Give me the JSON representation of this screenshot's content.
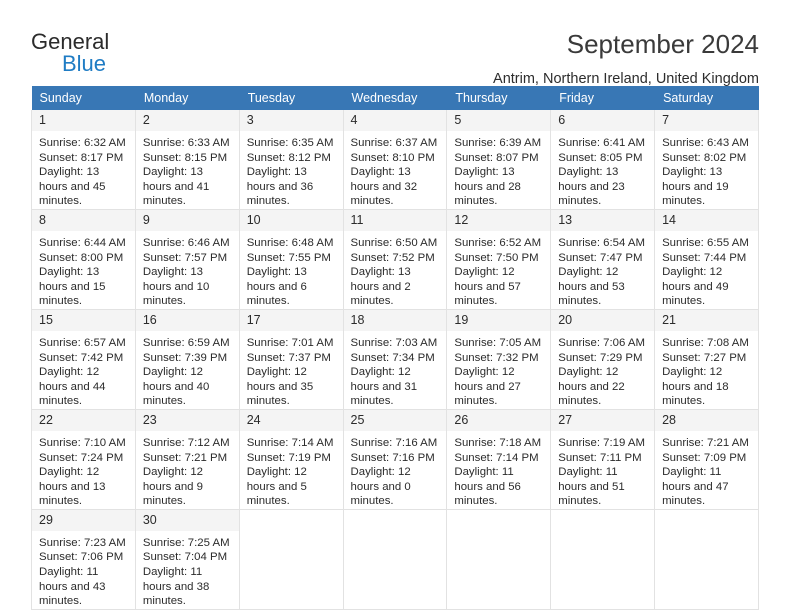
{
  "brand": {
    "name_part1": "General",
    "name_part2": "Blue",
    "triangle_color": "#1f7cc4"
  },
  "header": {
    "title": "September 2024",
    "location": "Antrim, Northern Ireland, United Kingdom"
  },
  "theme": {
    "header_blue": "#3877b5",
    "daynum_band": "#f4f4f4",
    "grid_border": "#e2e2e2"
  },
  "weekdays": [
    "Sunday",
    "Monday",
    "Tuesday",
    "Wednesday",
    "Thursday",
    "Friday",
    "Saturday"
  ],
  "labels": {
    "sunrise_prefix": "Sunrise:",
    "sunset_prefix": "Sunset:",
    "daylight_prefix": "Daylight:"
  },
  "weeks": [
    [
      {
        "day": "1",
        "sunrise": "Sunrise: 6:32 AM",
        "sunset": "Sunset: 8:17 PM",
        "daylight": "Daylight: 13 hours and 45 minutes."
      },
      {
        "day": "2",
        "sunrise": "Sunrise: 6:33 AM",
        "sunset": "Sunset: 8:15 PM",
        "daylight": "Daylight: 13 hours and 41 minutes."
      },
      {
        "day": "3",
        "sunrise": "Sunrise: 6:35 AM",
        "sunset": "Sunset: 8:12 PM",
        "daylight": "Daylight: 13 hours and 36 minutes."
      },
      {
        "day": "4",
        "sunrise": "Sunrise: 6:37 AM",
        "sunset": "Sunset: 8:10 PM",
        "daylight": "Daylight: 13 hours and 32 minutes."
      },
      {
        "day": "5",
        "sunrise": "Sunrise: 6:39 AM",
        "sunset": "Sunset: 8:07 PM",
        "daylight": "Daylight: 13 hours and 28 minutes."
      },
      {
        "day": "6",
        "sunrise": "Sunrise: 6:41 AM",
        "sunset": "Sunset: 8:05 PM",
        "daylight": "Daylight: 13 hours and 23 minutes."
      },
      {
        "day": "7",
        "sunrise": "Sunrise: 6:43 AM",
        "sunset": "Sunset: 8:02 PM",
        "daylight": "Daylight: 13 hours and 19 minutes."
      }
    ],
    [
      {
        "day": "8",
        "sunrise": "Sunrise: 6:44 AM",
        "sunset": "Sunset: 8:00 PM",
        "daylight": "Daylight: 13 hours and 15 minutes."
      },
      {
        "day": "9",
        "sunrise": "Sunrise: 6:46 AM",
        "sunset": "Sunset: 7:57 PM",
        "daylight": "Daylight: 13 hours and 10 minutes."
      },
      {
        "day": "10",
        "sunrise": "Sunrise: 6:48 AM",
        "sunset": "Sunset: 7:55 PM",
        "daylight": "Daylight: 13 hours and 6 minutes."
      },
      {
        "day": "11",
        "sunrise": "Sunrise: 6:50 AM",
        "sunset": "Sunset: 7:52 PM",
        "daylight": "Daylight: 13 hours and 2 minutes."
      },
      {
        "day": "12",
        "sunrise": "Sunrise: 6:52 AM",
        "sunset": "Sunset: 7:50 PM",
        "daylight": "Daylight: 12 hours and 57 minutes."
      },
      {
        "day": "13",
        "sunrise": "Sunrise: 6:54 AM",
        "sunset": "Sunset: 7:47 PM",
        "daylight": "Daylight: 12 hours and 53 minutes."
      },
      {
        "day": "14",
        "sunrise": "Sunrise: 6:55 AM",
        "sunset": "Sunset: 7:44 PM",
        "daylight": "Daylight: 12 hours and 49 minutes."
      }
    ],
    [
      {
        "day": "15",
        "sunrise": "Sunrise: 6:57 AM",
        "sunset": "Sunset: 7:42 PM",
        "daylight": "Daylight: 12 hours and 44 minutes."
      },
      {
        "day": "16",
        "sunrise": "Sunrise: 6:59 AM",
        "sunset": "Sunset: 7:39 PM",
        "daylight": "Daylight: 12 hours and 40 minutes."
      },
      {
        "day": "17",
        "sunrise": "Sunrise: 7:01 AM",
        "sunset": "Sunset: 7:37 PM",
        "daylight": "Daylight: 12 hours and 35 minutes."
      },
      {
        "day": "18",
        "sunrise": "Sunrise: 7:03 AM",
        "sunset": "Sunset: 7:34 PM",
        "daylight": "Daylight: 12 hours and 31 minutes."
      },
      {
        "day": "19",
        "sunrise": "Sunrise: 7:05 AM",
        "sunset": "Sunset: 7:32 PM",
        "daylight": "Daylight: 12 hours and 27 minutes."
      },
      {
        "day": "20",
        "sunrise": "Sunrise: 7:06 AM",
        "sunset": "Sunset: 7:29 PM",
        "daylight": "Daylight: 12 hours and 22 minutes."
      },
      {
        "day": "21",
        "sunrise": "Sunrise: 7:08 AM",
        "sunset": "Sunset: 7:27 PM",
        "daylight": "Daylight: 12 hours and 18 minutes."
      }
    ],
    [
      {
        "day": "22",
        "sunrise": "Sunrise: 7:10 AM",
        "sunset": "Sunset: 7:24 PM",
        "daylight": "Daylight: 12 hours and 13 minutes."
      },
      {
        "day": "23",
        "sunrise": "Sunrise: 7:12 AM",
        "sunset": "Sunset: 7:21 PM",
        "daylight": "Daylight: 12 hours and 9 minutes."
      },
      {
        "day": "24",
        "sunrise": "Sunrise: 7:14 AM",
        "sunset": "Sunset: 7:19 PM",
        "daylight": "Daylight: 12 hours and 5 minutes."
      },
      {
        "day": "25",
        "sunrise": "Sunrise: 7:16 AM",
        "sunset": "Sunset: 7:16 PM",
        "daylight": "Daylight: 12 hours and 0 minutes."
      },
      {
        "day": "26",
        "sunrise": "Sunrise: 7:18 AM",
        "sunset": "Sunset: 7:14 PM",
        "daylight": "Daylight: 11 hours and 56 minutes."
      },
      {
        "day": "27",
        "sunrise": "Sunrise: 7:19 AM",
        "sunset": "Sunset: 7:11 PM",
        "daylight": "Daylight: 11 hours and 51 minutes."
      },
      {
        "day": "28",
        "sunrise": "Sunrise: 7:21 AM",
        "sunset": "Sunset: 7:09 PM",
        "daylight": "Daylight: 11 hours and 47 minutes."
      }
    ],
    [
      {
        "day": "29",
        "sunrise": "Sunrise: 7:23 AM",
        "sunset": "Sunset: 7:06 PM",
        "daylight": "Daylight: 11 hours and 43 minutes."
      },
      {
        "day": "30",
        "sunrise": "Sunrise: 7:25 AM",
        "sunset": "Sunset: 7:04 PM",
        "daylight": "Daylight: 11 hours and 38 minutes."
      },
      {
        "day": "",
        "sunrise": "",
        "sunset": "",
        "daylight": ""
      },
      {
        "day": "",
        "sunrise": "",
        "sunset": "",
        "daylight": ""
      },
      {
        "day": "",
        "sunrise": "",
        "sunset": "",
        "daylight": ""
      },
      {
        "day": "",
        "sunrise": "",
        "sunset": "",
        "daylight": ""
      },
      {
        "day": "",
        "sunrise": "",
        "sunset": "",
        "daylight": ""
      }
    ]
  ]
}
